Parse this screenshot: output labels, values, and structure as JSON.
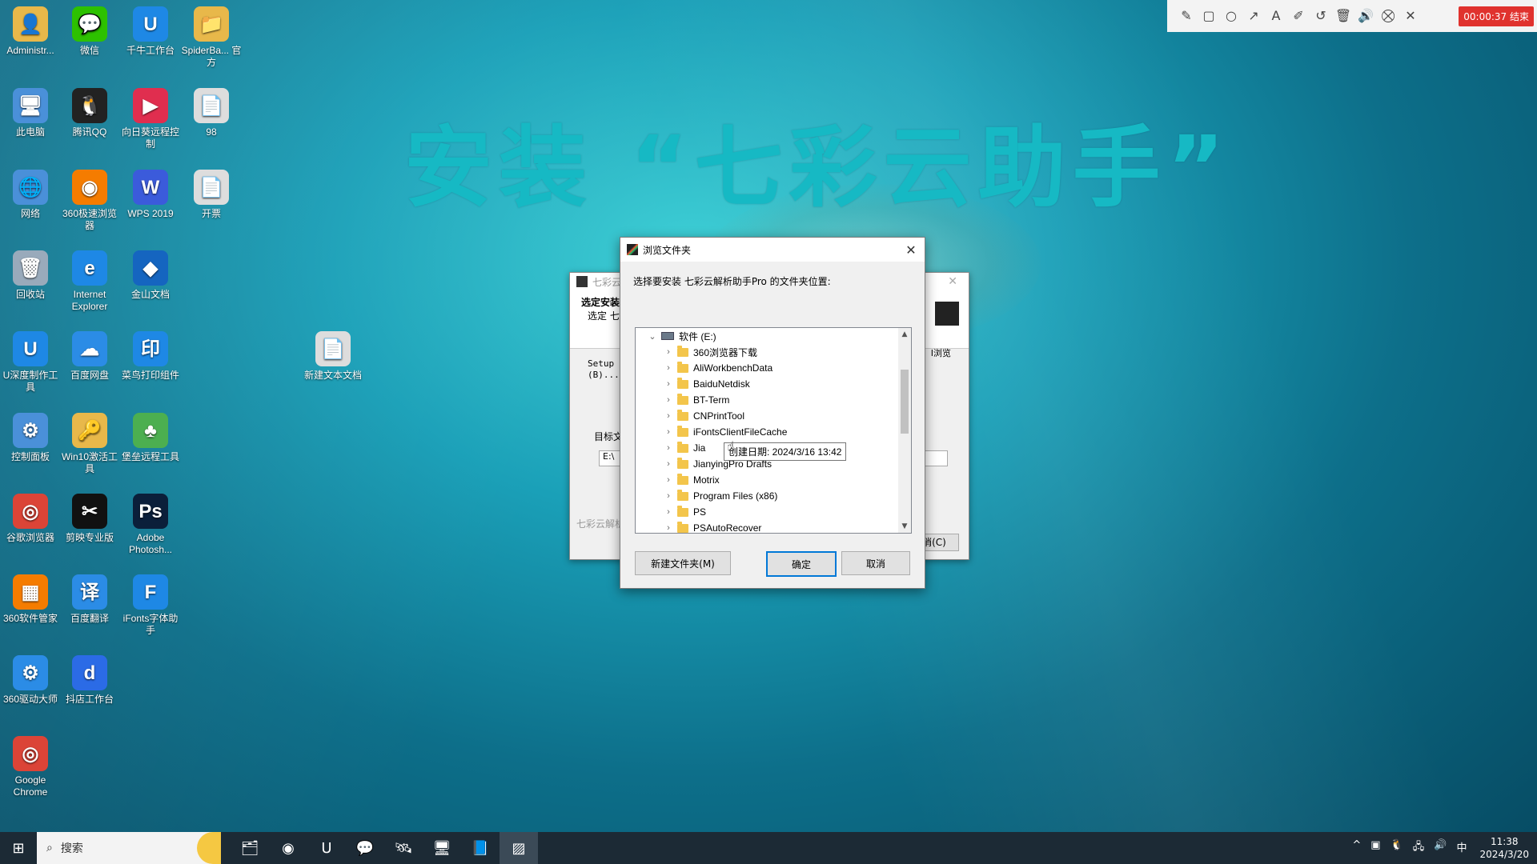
{
  "banner": "安装 “七彩云助手”",
  "desktop_icons": [
    {
      "label": "Administr...",
      "glyph": "👤",
      "color": "#e8b84a"
    },
    {
      "label": "微信",
      "glyph": "💬",
      "color": "#2dc100"
    },
    {
      "label": "千牛工作台",
      "glyph": "U",
      "color": "#1e88e5"
    },
    {
      "label": "SpiderBa... 官方",
      "glyph": "📁",
      "color": "#e8b84a"
    },
    {
      "label": "此电脑",
      "glyph": "🖥",
      "color": "#4a90d9"
    },
    {
      "label": "腾讯QQ",
      "glyph": "🐧",
      "color": "#222222"
    },
    {
      "label": "向日葵远程控制",
      "glyph": "▶",
      "color": "#e02e4f"
    },
    {
      "label": "98",
      "glyph": "📄",
      "color": "#dddddd"
    },
    {
      "label": "网络",
      "glyph": "🌐",
      "color": "#4a90d9"
    },
    {
      "label": "360极速浏览器",
      "glyph": "◉",
      "color": "#f57c00"
    },
    {
      "label": "开票",
      "glyph": "📄",
      "color": "#dddddd"
    },
    {
      "label": "回收站",
      "glyph": "🗑",
      "color": "#9ab"
    },
    {
      "label": "Internet Explorer",
      "glyph": "e",
      "color": "#1e88e5"
    },
    {
      "label": "WPS 2019",
      "glyph": "W",
      "color": "#3b5bdb"
    },
    {
      "label": "U深度制作工具",
      "glyph": "U",
      "color": "#1e88e5"
    },
    {
      "label": "百度网盘",
      "glyph": "☁",
      "color": "#2b8ce6"
    },
    {
      "label": "金山文档",
      "glyph": "◆",
      "color": "#1565c0"
    },
    {
      "label": "新建文本文档",
      "glyph": "📄",
      "color": "#dddddd"
    },
    {
      "label": "控制面板",
      "glyph": "⚙",
      "color": "#4a90d9"
    },
    {
      "label": "Win10激活工具",
      "glyph": "🔑",
      "color": "#e8b84a"
    },
    {
      "label": "菜鸟打印组件",
      "glyph": "印",
      "color": "#1e88e5"
    },
    {
      "label": "谷歌浏览器",
      "glyph": "◎",
      "color": "#db4437"
    },
    {
      "label": "剪映专业版",
      "glyph": "✂",
      "color": "#111111"
    },
    {
      "label": "堡垒远程工具",
      "glyph": "♣",
      "color": "#4caf50"
    },
    {
      "label": "360软件管家",
      "glyph": "▦",
      "color": "#f57c00"
    },
    {
      "label": "百度翻译",
      "glyph": "译",
      "color": "#2b8ce6"
    },
    {
      "label": "Adobe Photosh...",
      "glyph": "Ps",
      "color": "#0b1f3a"
    },
    {
      "label": "360驱动大师",
      "glyph": "⚙",
      "color": "#2b8ce6"
    },
    {
      "label": "抖店工作台",
      "glyph": "d",
      "color": "#2b6be6"
    },
    {
      "label": "iFonts字体助手",
      "glyph": "F",
      "color": "#1e88e5"
    },
    {
      "label": "Google Chrome",
      "glyph": "◎",
      "color": "#db4437"
    }
  ],
  "rec_toolbar": {
    "icons": [
      "pencil-icon",
      "rectangle-icon",
      "circle-icon",
      "arrow-icon",
      "text-icon",
      "highlighter-icon",
      "undo-icon",
      "trash-icon",
      "speaker-icon",
      "camera-off-icon",
      "close-icon"
    ],
    "glyphs": [
      "✎",
      "▢",
      "○",
      "↗",
      "A",
      "✐",
      "↺",
      "🗑",
      "🔊",
      "⛒",
      "✕"
    ],
    "timer": "00:00:37 结束"
  },
  "installer": {
    "title": "七彩云",
    "header_bold": "选定安装",
    "header_sub": "选定 七",
    "setup_text": "Setup 将",
    "setup_text2": "(B)...",
    "browse_hint": "I浏览",
    "target_label": "目标文",
    "target_path": "E:\\",
    "footer": "七彩云解析",
    "cancel_btn": "消(C)"
  },
  "dialog": {
    "title": "浏览文件夹",
    "prompt": "选择要安装 七彩云解析助手Pro 的文件夹位置:",
    "root": "软件 (E:)",
    "folders": [
      "360浏览器下载",
      "AliWorkbenchData",
      "BaiduNetdisk",
      "BT-Term",
      "CNPrintTool",
      "iFontsClientFileCache",
      "Jia",
      "JianyingPro Drafts",
      "Motrix",
      "Program Files (x86)",
      "PS",
      "PSAutoRecover"
    ],
    "tooltip": "创建日期: 2024/3/16 13:42",
    "new_folder": "新建文件夹(M)",
    "ok": "确定",
    "cancel": "取消"
  },
  "taskbar": {
    "search_placeholder": "搜索",
    "apps": [
      "🗂",
      "◉",
      "U",
      "💬",
      "🛰",
      "🖥",
      "📘",
      "▨"
    ],
    "tray": [
      "^",
      "▣",
      "🐧",
      "🖧",
      "🔊",
      "中"
    ],
    "time": "11:38",
    "date": "2024/3/20"
  }
}
